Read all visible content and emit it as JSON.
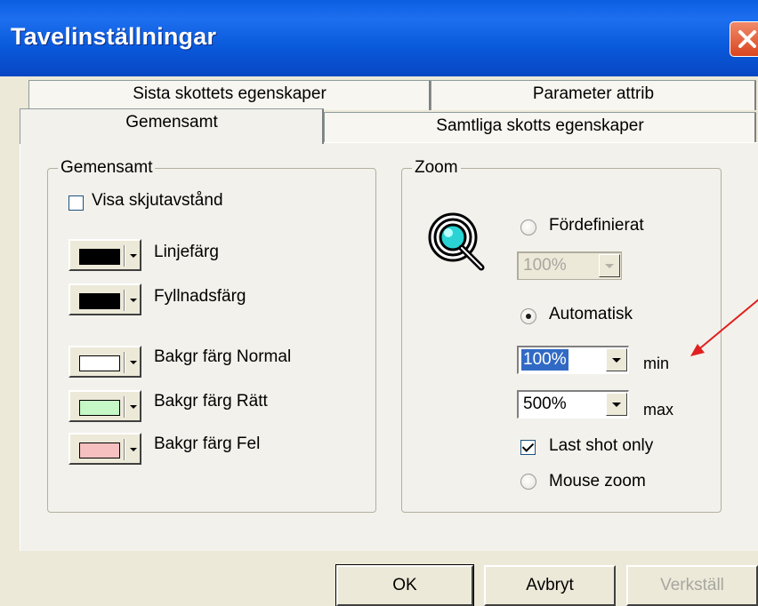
{
  "window": {
    "title": "Tavelinställningar"
  },
  "tabs": {
    "back": [
      "Sista skottets egenskaper",
      "Parameter attrib"
    ],
    "front": [
      "Gemensamt",
      "Samtliga skotts egenskaper"
    ],
    "active": "Gemensamt"
  },
  "common": {
    "legend": "Gemensamt",
    "show_distance_label": "Visa skjutavstånd",
    "show_distance_checked": false,
    "colors": [
      {
        "label": "Linjefärg",
        "color": "#000000"
      },
      {
        "label": "Fyllnadsfärg",
        "color": "#000000"
      },
      {
        "label": "Bakgr färg Normal",
        "color": "#ffffff"
      },
      {
        "label": "Bakgr färg Rätt",
        "color": "#c6f7c6"
      },
      {
        "label": "Bakgr färg Fel",
        "color": "#f7c0c0"
      }
    ]
  },
  "zoom": {
    "legend": "Zoom",
    "icon": "magnifier-target-icon",
    "predefined_label": "Fördefinierat",
    "predefined_value": "100%",
    "auto_label": "Automatisk",
    "min_value": "100%",
    "min_label": "min",
    "max_value": "500%",
    "max_label": "max",
    "last_shot_label": "Last shot only",
    "last_shot_checked": true,
    "mouse_zoom_label": "Mouse zoom",
    "selected_mode": "Automatisk"
  },
  "buttons": {
    "ok": "OK",
    "cancel": "Avbryt",
    "apply": "Verkställ"
  },
  "annotation_color": "#e02020"
}
